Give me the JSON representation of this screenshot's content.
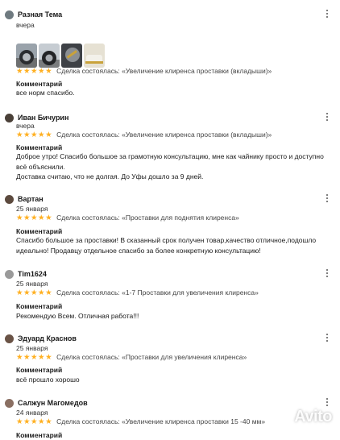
{
  "reviews": [
    {
      "name": "Разная Тема",
      "date": "вчера",
      "stars": "★★★★★",
      "deal": "Сделка состоялась: «Увеличение клиренса проставки (вкладыши)»",
      "comment_label": "Комментарий",
      "comment": [
        "все норм спасибо."
      ]
    },
    {
      "name": "Иван Бичурин",
      "date": "вчера",
      "stars": "★★★★★",
      "deal": "Сделка состоялась: «Увеличение клиренса проставки (вкладыши)»",
      "comment_label": "Комментарий",
      "comment": [
        "Доброе утро! Спасибо большое за грамотную консультацию, мне как чайнику просто и доступно всё объяснили.",
        "Доставка считаю, что не долгая. До Уфы дошло за 9 дней."
      ]
    },
    {
      "name": "Вартан",
      "date": "25 января",
      "stars": "★★★★★",
      "deal": "Сделка состоялась: «Проставки для поднятия клиренса»",
      "comment_label": "Комментарий",
      "comment": [
        "Спасибо большое за проставки! В сказанный срок получен товар,качество отличное,подошло идеально! Продавцу отдельное спасибо за более конкретную консультацию!"
      ]
    },
    {
      "name": "Tim1624",
      "date": "25 января",
      "stars": "★★★★★",
      "deal": "Сделка состоялась: «1-7 Проставки для увеличения клиренса»",
      "comment_label": "Комментарий",
      "comment": [
        "Рекомендую Всем. Отличная работа!!!"
      ]
    },
    {
      "name": "Эдуард Краснов",
      "date": "25 января",
      "stars": "★★★★★",
      "deal": "Сделка состоялась: «Проставки для увеличения клиренса»",
      "comment_label": "Комментарий",
      "comment": [
        "всё прошло хорошо"
      ]
    },
    {
      "name": "Салжун Магомедов",
      "date": "24 января",
      "stars": "★★★★★",
      "deal": "Сделка состоялась: «Увеличение клиренса проставки 15 -40 мм»",
      "comment_label": "Комментарий",
      "comment": []
    }
  ],
  "watermark": "Avito",
  "colors": {
    "star": "#ffb021",
    "text": "#1a1a1a",
    "muted": "#444444"
  }
}
